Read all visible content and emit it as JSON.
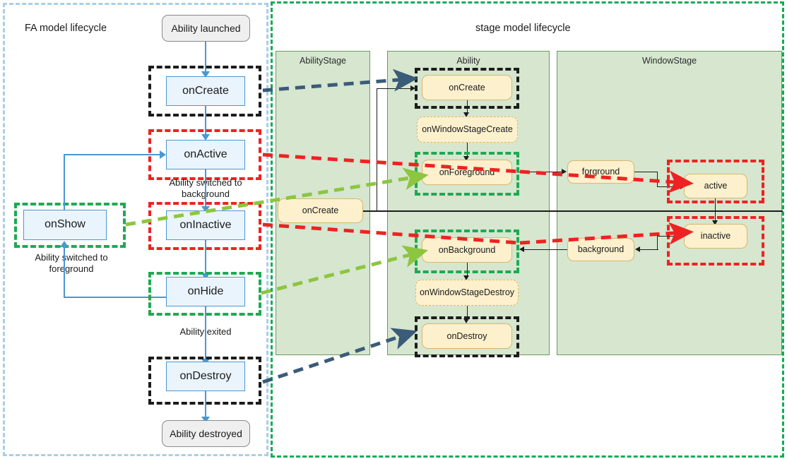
{
  "diagram": {
    "fa": {
      "title": "FA model lifecycle",
      "nodes": {
        "launched": "Ability launched",
        "on_create": "onCreate",
        "on_active": "onActive",
        "on_show": "onShow",
        "on_inactive": "onInactive",
        "on_hide": "onHide",
        "on_destroy": "onDestroy",
        "destroyed": "Ability destroyed"
      },
      "labels": {
        "to_background": "Ability switched to\nbackground",
        "to_background_l1": "Ability switched to",
        "to_background_l2": "background",
        "to_foreground_l1": "Ability switched to",
        "to_foreground_l2": "foreground",
        "exited": "Ability exited"
      }
    },
    "stage": {
      "title": "stage model lifecycle",
      "lanes": {
        "ability_stage": "AbilityStage",
        "ability": "Ability",
        "window_stage": "WindowStage"
      },
      "nodes": {
        "abilitystage_on_create": "onCreate",
        "ability_on_create": "onCreate",
        "on_window_stage_create": "onWindowStageCreate",
        "on_foreground": "onForeground",
        "on_background": "onBackground",
        "on_window_stage_destroy": "onWindowStageDestroy",
        "ability_on_destroy": "onDestroy",
        "forground": "forground",
        "active": "active",
        "background": "background",
        "inactive": "inactive"
      }
    },
    "colors": {
      "highlight_black": "#1c1c1c",
      "highlight_red": "#ee2222",
      "highlight_green": "#1eaa52",
      "mapping_dark_blue": "#3b5c78",
      "mapping_red": "#ee2222",
      "mapping_light_green": "#8cc63f",
      "lane_fill": "#d6e6cf",
      "fa_node_fill": "#eaf4fd",
      "fa_node_border": "#4a97d2",
      "stage_node_fill": "#fdf0cd",
      "stage_node_border": "#d6b871",
      "fa_container_border": "#a8cfe5",
      "stage_container_border": "#13ab57"
    }
  }
}
